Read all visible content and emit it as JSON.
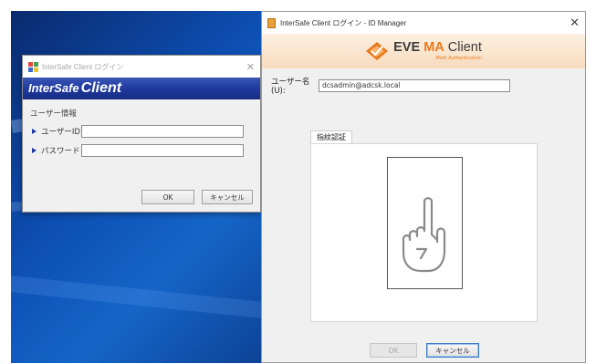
{
  "login_window": {
    "title": "InterSafe Client ログイン",
    "banner_logo_part1": "InterSafe",
    "banner_logo_part2": "Client",
    "section_label": "ユーザー情報",
    "user_id_label": "ユーザーID",
    "user_id_value": "",
    "password_label": "パスワード",
    "password_value": "",
    "ok_label": "OK",
    "cancel_label": "キャンセル",
    "close_symbol": "✕"
  },
  "idm_window": {
    "title": "InterSafe Client ログイン - ID Manager",
    "close_symbol": "✕",
    "logo_part1": "EVE ",
    "logo_part2": "MA",
    "logo_part3": " Client",
    "logo_tagline": "Multi Authentication",
    "username_label": "ユーザー名(U):",
    "username_value": "dcsadmin@adcsk.local",
    "tab_label": "指紋認証",
    "ok_label": "OK",
    "cancel_label": "キャンセル"
  },
  "icons": {
    "login_app_icon": "intersafe-app-icon",
    "idm_app_icon": "id-manager-app-icon",
    "eve_logo": "eve-diamond-logo",
    "fingerprint_hand": "finger-pointing-hand-icon",
    "field_arrow": "triangle-right-icon"
  },
  "colors": {
    "banner_blue": "#1f3a9e",
    "accent_orange": "#e87a1e",
    "desktop_blue": "#0d4fb3"
  }
}
